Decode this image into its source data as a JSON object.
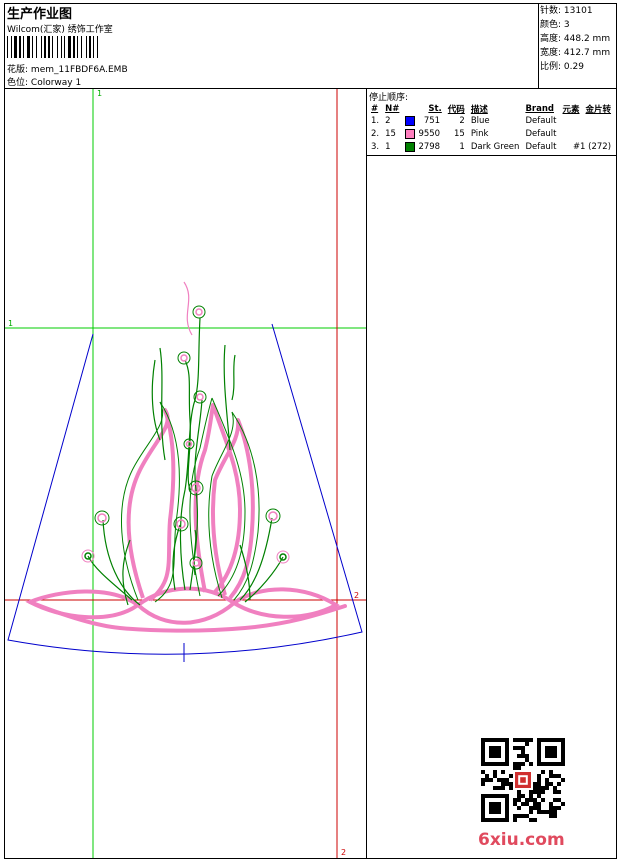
{
  "header": {
    "title": "生产作业图",
    "company": "Wilcom(汇家) 绣饰工作室",
    "design_label": "花版:",
    "design_file": "mem_11FBDF6A.EMB",
    "colorway_label": "色位:",
    "colorway": "Colorway 1"
  },
  "stats": [
    {
      "label": "针数:",
      "value": "13101"
    },
    {
      "label": "颜色:",
      "value": "3"
    },
    {
      "label": "高度:",
      "value": "448.2 mm"
    },
    {
      "label": "宽度:",
      "value": "412.7 mm"
    },
    {
      "label": "比例:",
      "value": "0.29"
    }
  ],
  "stop_sequence": {
    "title": "停止顺序:",
    "headers": [
      "#",
      "N#",
      "St.",
      "代码",
      "描述",
      "Brand",
      "元素",
      "金片转"
    ],
    "rows": [
      {
        "idx": "1.",
        "n": "2",
        "color": "#0000ff",
        "st": "751",
        "code": "2",
        "desc": "Blue",
        "brand": "Default",
        "elem": "",
        "seq": ""
      },
      {
        "idx": "2.",
        "n": "15",
        "color": "#ff7fbf",
        "st": "9550",
        "code": "15",
        "desc": "Pink",
        "brand": "Default",
        "elem": "",
        "seq": ""
      },
      {
        "idx": "3.",
        "n": "1",
        "color": "#008000",
        "st": "2798",
        "code": "1",
        "desc": "Dark Green",
        "brand": "Default",
        "elem": "#1 (272)",
        "seq": ""
      }
    ]
  },
  "guides": {
    "green_top": "1",
    "green_left": "1",
    "red_right": "2",
    "red_bottom": "2"
  },
  "colors": {
    "green_guide": "#00cc00",
    "red_guide": "#cc0000",
    "blue_outline": "#0000cc",
    "pink_thread": "#f080c0",
    "green_thread": "#008000"
  },
  "watermark": "6xiu.com"
}
